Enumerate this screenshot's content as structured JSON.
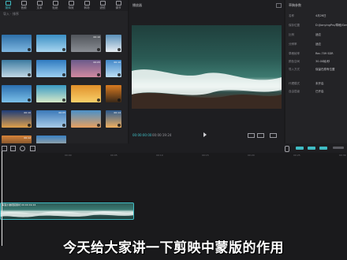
{
  "toolbar": {
    "items": [
      {
        "label": "媒体",
        "icon": "media-icon"
      },
      {
        "label": "音频",
        "icon": "audio-icon"
      },
      {
        "label": "文本",
        "icon": "text-icon"
      },
      {
        "label": "贴纸",
        "icon": "sticker-icon"
      },
      {
        "label": "特效",
        "icon": "effect-icon"
      },
      {
        "label": "转场",
        "icon": "transition-icon"
      },
      {
        "label": "滤镜",
        "icon": "filter-icon"
      },
      {
        "label": "调节",
        "icon": "adjust-icon"
      }
    ]
  },
  "media": {
    "sort_label": "导入 · 排序",
    "thumbnails": [
      {
        "dur": "",
        "colors": [
          "#2d6fa8",
          "#7fb7e0"
        ]
      },
      {
        "dur": "",
        "colors": [
          "#3a8fc4",
          "#a9d6f0"
        ]
      },
      {
        "dur": "00:10",
        "colors": [
          "#50545a",
          "#8a8e94"
        ]
      },
      {
        "dur": "",
        "colors": [
          "#5a8fb8",
          "#e8eef4"
        ]
      },
      {
        "dur": "",
        "colors": [
          "#3c7aa0",
          "#c2d8e6"
        ]
      },
      {
        "dur": "",
        "colors": [
          "#2f7ac0",
          "#9cd0f2"
        ]
      },
      {
        "dur": "00:05",
        "colors": [
          "#6a5a8a",
          "#d28aa0"
        ]
      },
      {
        "dur": "00:10",
        "colors": [
          "#3f86c8",
          "#bfe0f6"
        ]
      },
      {
        "dur": "",
        "colors": [
          "#2b6fb0",
          "#7cc0e8"
        ]
      },
      {
        "dur": "",
        "colors": [
          "#3a9ac4",
          "#d6e9c8"
        ]
      },
      {
        "dur": "",
        "colors": [
          "#e0902a",
          "#f8d06a"
        ]
      },
      {
        "dur": "",
        "colors": [
          "#d87a20",
          "#3a2818"
        ]
      },
      {
        "dur": "00:10",
        "colors": [
          "#1e3c78",
          "#e0a04a"
        ]
      },
      {
        "dur": "00:05",
        "colors": [
          "#3a78b8",
          "#a8cce8"
        ]
      },
      {
        "dur": "",
        "colors": [
          "#4a90c8",
          "#e8a060"
        ]
      },
      {
        "dur": "00:14",
        "colors": [
          "#2a5a90",
          "#f0b060"
        ]
      },
      {
        "dur": "00:12",
        "colors": [
          "#d8843a",
          "#2a2420"
        ]
      },
      {
        "dur": "",
        "colors": [
          "#3a7fc0",
          "#f0c890"
        ]
      }
    ]
  },
  "player": {
    "title": "播放器",
    "time_current": "00:00:00:00",
    "time_total": "00:00:19:24"
  },
  "props": {
    "title": "草稿参数",
    "rows": [
      {
        "key": "名称",
        "value": "4月26日"
      },
      {
        "key": "保存位置",
        "value": "D:/JianyingPro/草稿/Gen"
      },
      {
        "key": "比例",
        "value": "适应"
      },
      {
        "key": "分辨率",
        "value": "适应"
      },
      {
        "key": "草稿帧率",
        "value": "Rec.709 SDR"
      },
      {
        "key": "颜色空间",
        "value": "30.00帧/秒"
      },
      {
        "key": "导入方式",
        "value": "保留在原有位置"
      },
      {
        "key": "代理模式",
        "value": "未开启"
      },
      {
        "key": "自由层级",
        "value": "已开启"
      }
    ]
  },
  "timeline": {
    "ruler": [
      "00:00",
      "00:05",
      "00:10",
      "00:15",
      "00:20",
      "00:25",
      "00:30"
    ],
    "clip_name": "海浪沙滩视频素材 00:00:19:24"
  },
  "subtitle": "今天给大家讲一下剪映中蒙版的作用",
  "colors": {
    "accent": "#3fbcc4",
    "background": "#1a1a1c",
    "panel": "#232326"
  }
}
